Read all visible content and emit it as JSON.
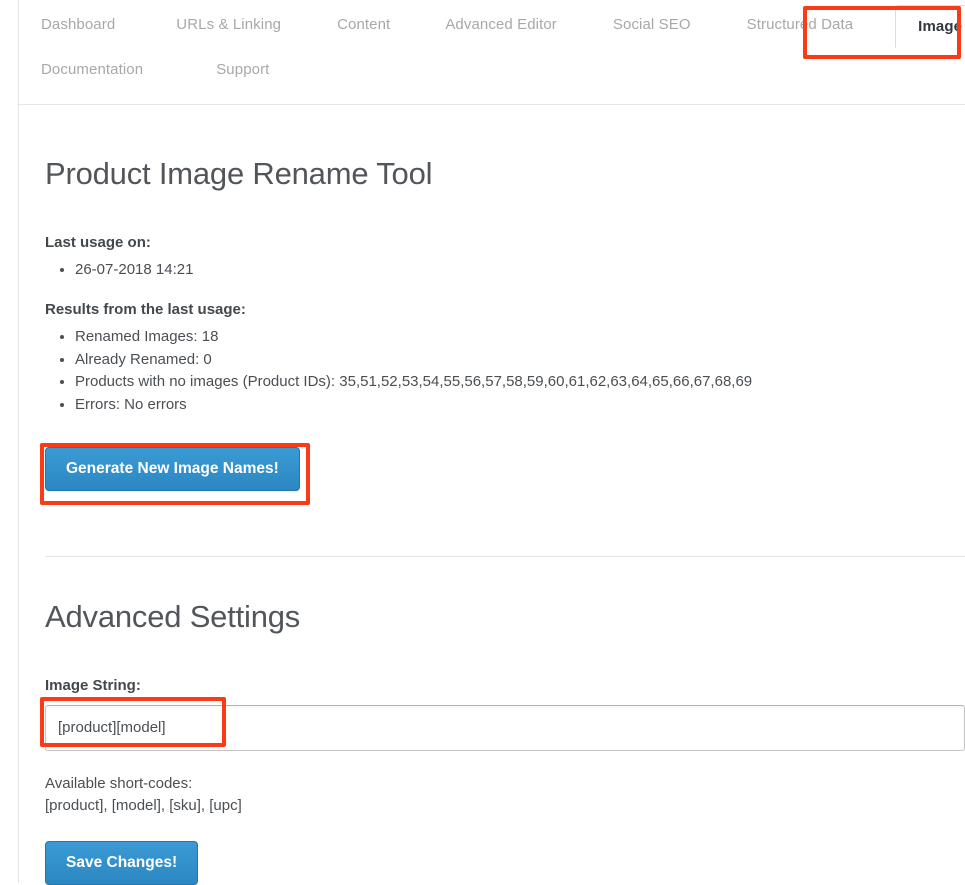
{
  "tabs": {
    "row1": [
      {
        "label": "Dashboard",
        "active": false
      },
      {
        "label": "URLs & Linking",
        "active": false
      },
      {
        "label": "Content",
        "active": false
      },
      {
        "label": "Advanced Editor",
        "active": false
      },
      {
        "label": "Social SEO",
        "active": false
      },
      {
        "label": "Structured Data",
        "active": false
      },
      {
        "label": "Image Names",
        "active": true
      }
    ],
    "row2": [
      {
        "label": "Documentation",
        "active": false
      },
      {
        "label": "Support",
        "active": false
      }
    ]
  },
  "main": {
    "title": "Product Image Rename Tool",
    "last_usage_label": "Last usage on:",
    "last_usage_value": "26-07-2018 14:21",
    "results_label": "Results from the last usage:",
    "results": [
      "Renamed Images: 18",
      "Already Renamed: 0",
      "Products with no images (Product IDs): 35,51,52,53,54,55,56,57,58,59,60,61,62,63,64,65,66,67,68,69",
      "Errors: No errors"
    ],
    "generate_button": "Generate New Image Names!"
  },
  "advanced": {
    "title": "Advanced Settings",
    "image_string_label": "Image String:",
    "image_string_value": "[product][model]",
    "image_string_placeholder": "",
    "shortcodes_label": "Available short-codes:",
    "shortcodes_value": "[product], [model], [sku], [upc]",
    "save_button": "Save Changes!"
  },
  "colors": {
    "primary_blue": "#2e8dc8",
    "annotation_red": "#fb3b17",
    "tab_inactive": "#a8a8a8",
    "tab_active": "#31373d",
    "body_text": "#4a4f54",
    "heading": "#52565a",
    "rule": "#e6e6e6"
  },
  "annotations": [
    {
      "target": "tab-image-names"
    },
    {
      "target": "generate-button"
    },
    {
      "target": "image-string-input"
    }
  ]
}
